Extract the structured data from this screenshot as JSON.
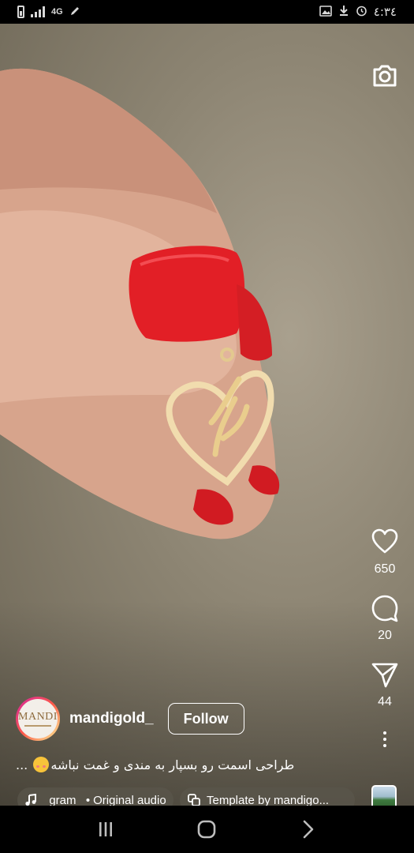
{
  "status_bar": {
    "network": "4G",
    "time": "٤:٣٤",
    "icons": [
      "battery-icon",
      "signal-icon",
      "edit-icon",
      "image-icon",
      "download-icon",
      "alarm-icon"
    ]
  },
  "reel": {
    "author": {
      "username": "mandigold_",
      "avatar_text": "MANDI",
      "follow_label": "Follow"
    },
    "caption": {
      "text": "طراحی اسمت رو بسپار به مندی و غمت نباشه",
      "more": "..."
    },
    "audio": {
      "label": "_gram_",
      "separator": "•",
      "source": "Original audio"
    },
    "template": {
      "label": "Template by mandigo..."
    },
    "actions": {
      "likes": "650",
      "comments": "20",
      "shares": "44"
    }
  },
  "nav_bar": {
    "buttons": [
      "recents-icon",
      "home-icon",
      "back-icon"
    ]
  }
}
